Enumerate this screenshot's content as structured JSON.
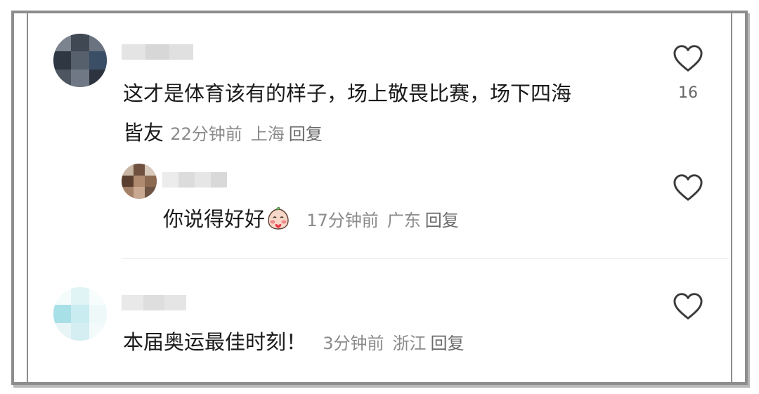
{
  "comments": [
    {
      "text": "这才是体育该有的样子，场上敬畏比赛，场下四海皆友",
      "line1": "这才是体育该有的样子，场上敬畏比赛，场下四海",
      "line2": "皆友",
      "time": "22分钟前",
      "location": "上海",
      "reply_label": "回复",
      "likes": "16",
      "colors": {
        "avatar": "#4a5568"
      }
    },
    {
      "text": "你说得好好",
      "time": "17分钟前",
      "location": "广东",
      "reply_label": "回复",
      "emoji_icon": "blushing-peach-emoji",
      "is_reply": true,
      "colors": {
        "avatar": "#8a6a55"
      }
    },
    {
      "text": "本届奥运最佳时刻！",
      "time": "3分钟前",
      "location": "浙江",
      "reply_label": "回复",
      "colors": {
        "avatar": "#a8e0e8"
      }
    }
  ],
  "icons": {
    "like": "heart-outline-icon"
  },
  "colors": {
    "text": "#1a1a1a",
    "meta": "#8a8a8a",
    "frame": "#8d8d8d"
  }
}
